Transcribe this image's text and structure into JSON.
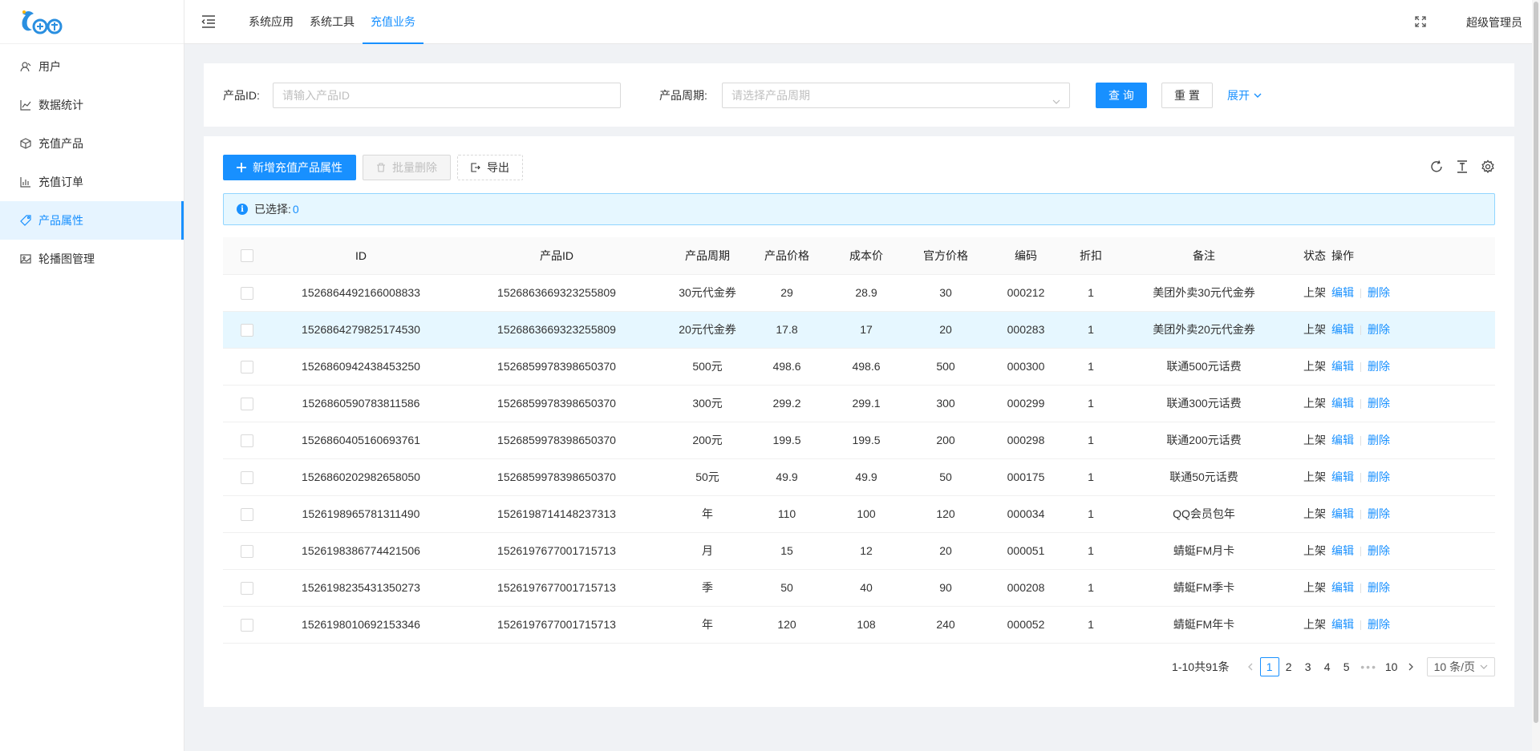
{
  "sidebar": {
    "items": [
      {
        "label": "用户",
        "icon": "user-icon"
      },
      {
        "label": "数据统计",
        "icon": "line-chart-icon"
      },
      {
        "label": "充值产品",
        "icon": "cube-icon"
      },
      {
        "label": "充值订单",
        "icon": "bar-chart-icon"
      },
      {
        "label": "产品属性",
        "icon": "tag-icon",
        "active": true
      },
      {
        "label": "轮播图管理",
        "icon": "picture-icon"
      }
    ]
  },
  "header": {
    "tabs": [
      {
        "label": "系统应用"
      },
      {
        "label": "系统工具"
      },
      {
        "label": "充值业务",
        "active": true
      }
    ],
    "user": "超级管理员"
  },
  "search": {
    "product_id_label": "产品ID:",
    "product_id_placeholder": "请输入产品ID",
    "period_label": "产品周期:",
    "period_placeholder": "请选择产品周期",
    "query_label": "查 询",
    "reset_label": "重 置",
    "expand_label": "展开"
  },
  "toolbar": {
    "add_label": "新增充值产品属性",
    "batch_delete_label": "批量删除",
    "export_label": "导出"
  },
  "alert": {
    "selected_label": "已选择:",
    "selected_count": "0"
  },
  "table": {
    "columns": [
      "ID",
      "产品ID",
      "产品周期",
      "产品价格",
      "成本价",
      "官方价格",
      "编码",
      "折扣",
      "备注",
      "状态",
      "操作"
    ],
    "edit_label": "编辑",
    "delete_label": "删除",
    "rows": [
      {
        "id": "1526864492166008833",
        "product_id": "1526863669323255809",
        "period": "30元代金券",
        "price": "29",
        "cost": "28.9",
        "official": "30",
        "code": "000212",
        "discount": "1",
        "note": "美团外卖30元代金券",
        "status": "上架"
      },
      {
        "id": "1526864279825174530",
        "product_id": "1526863669323255809",
        "period": "20元代金券",
        "price": "17.8",
        "cost": "17",
        "official": "20",
        "code": "000283",
        "discount": "1",
        "note": "美团外卖20元代金券",
        "status": "上架"
      },
      {
        "id": "1526860942438453250",
        "product_id": "1526859978398650370",
        "period": "500元",
        "price": "498.6",
        "cost": "498.6",
        "official": "500",
        "code": "000300",
        "discount": "1",
        "note": "联通500元话费",
        "status": "上架"
      },
      {
        "id": "1526860590783811586",
        "product_id": "1526859978398650370",
        "period": "300元",
        "price": "299.2",
        "cost": "299.1",
        "official": "300",
        "code": "000299",
        "discount": "1",
        "note": "联通300元话费",
        "status": "上架"
      },
      {
        "id": "1526860405160693761",
        "product_id": "1526859978398650370",
        "period": "200元",
        "price": "199.5",
        "cost": "199.5",
        "official": "200",
        "code": "000298",
        "discount": "1",
        "note": "联通200元话费",
        "status": "上架"
      },
      {
        "id": "1526860202982658050",
        "product_id": "1526859978398650370",
        "period": "50元",
        "price": "49.9",
        "cost": "49.9",
        "official": "50",
        "code": "000175",
        "discount": "1",
        "note": "联通50元话费",
        "status": "上架"
      },
      {
        "id": "1526198965781311490",
        "product_id": "1526198714148237313",
        "period": "年",
        "price": "110",
        "cost": "100",
        "official": "120",
        "code": "000034",
        "discount": "1",
        "note": "QQ会员包年",
        "status": "上架"
      },
      {
        "id": "1526198386774421506",
        "product_id": "1526197677001715713",
        "period": "月",
        "price": "15",
        "cost": "12",
        "official": "20",
        "code": "000051",
        "discount": "1",
        "note": "蜻蜓FM月卡",
        "status": "上架"
      },
      {
        "id": "1526198235431350273",
        "product_id": "1526197677001715713",
        "period": "季",
        "price": "50",
        "cost": "40",
        "official": "90",
        "code": "000208",
        "discount": "1",
        "note": "蜻蜓FM季卡",
        "status": "上架"
      },
      {
        "id": "1526198010692153346",
        "product_id": "1526197677001715713",
        "period": "年",
        "price": "120",
        "cost": "108",
        "official": "240",
        "code": "000052",
        "discount": "1",
        "note": "蜻蜓FM年卡",
        "status": "上架"
      }
    ]
  },
  "pagination": {
    "total_label": "1-10共91条",
    "pages": [
      "1",
      "2",
      "3",
      "4",
      "5"
    ],
    "ellipsis": "•••",
    "last_page": "10",
    "current": "1",
    "page_size_label": "10 条/页"
  }
}
